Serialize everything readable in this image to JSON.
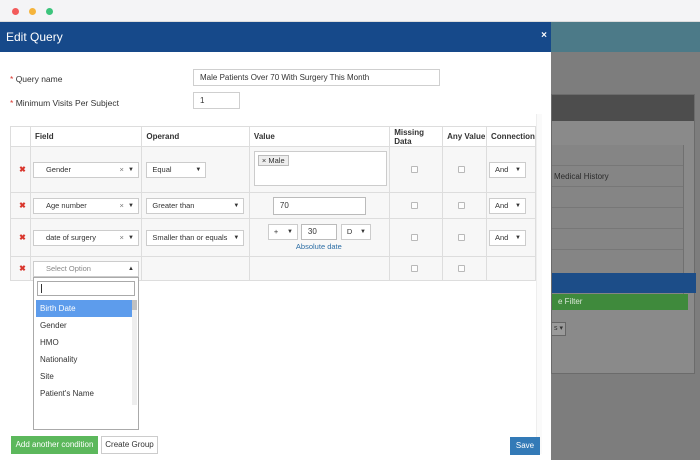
{
  "colors": {
    "header": "#16498a",
    "required": "#d9362d",
    "add_button": "#5cb85c",
    "save_button": "#337ab7",
    "highlight": "#5d9cec"
  },
  "window_controls": [
    "close-dot",
    "minimize-dot",
    "maximize-dot"
  ],
  "modal": {
    "title": "Edit Query",
    "close_icon": "×",
    "query_name_label": "Query name",
    "query_name_value": "Male Patients Over 70 With Surgery This Month",
    "min_visits_label": "Minimum Visits Per Subject",
    "min_visits_value": "1",
    "required_mark": "*"
  },
  "table": {
    "headers": [
      "Field",
      "Operand",
      "Value",
      "Missing Data",
      "Any Value",
      "Connection"
    ],
    "delete_icon": "✖",
    "rows": [
      {
        "field": "Gender",
        "operand": "Equal",
        "value_tag": "Male",
        "connection": "And"
      },
      {
        "field": "Age number",
        "operand": "Greater than",
        "value": "70",
        "connection": "And"
      },
      {
        "field": "date of surgery",
        "operand": "Smaller than or equals",
        "sign": "+",
        "amount": "30",
        "unit": "D",
        "absolute_date_link": "Absolute date",
        "connection": "And"
      },
      {
        "field_placeholder": "Select Option"
      }
    ]
  },
  "dropdown": {
    "options": [
      "Birth Date",
      "Gender",
      "HMO",
      "Nationality",
      "Site",
      "Patient's Name"
    ],
    "highlighted_index": 0
  },
  "footer": {
    "add_condition_label": "Add another condition",
    "create_group_label": "Create Group",
    "save_label": "Save"
  },
  "background": {
    "list_item": "Medical History",
    "filter_button_fragment": "e Filter",
    "select_fragment": "s"
  }
}
